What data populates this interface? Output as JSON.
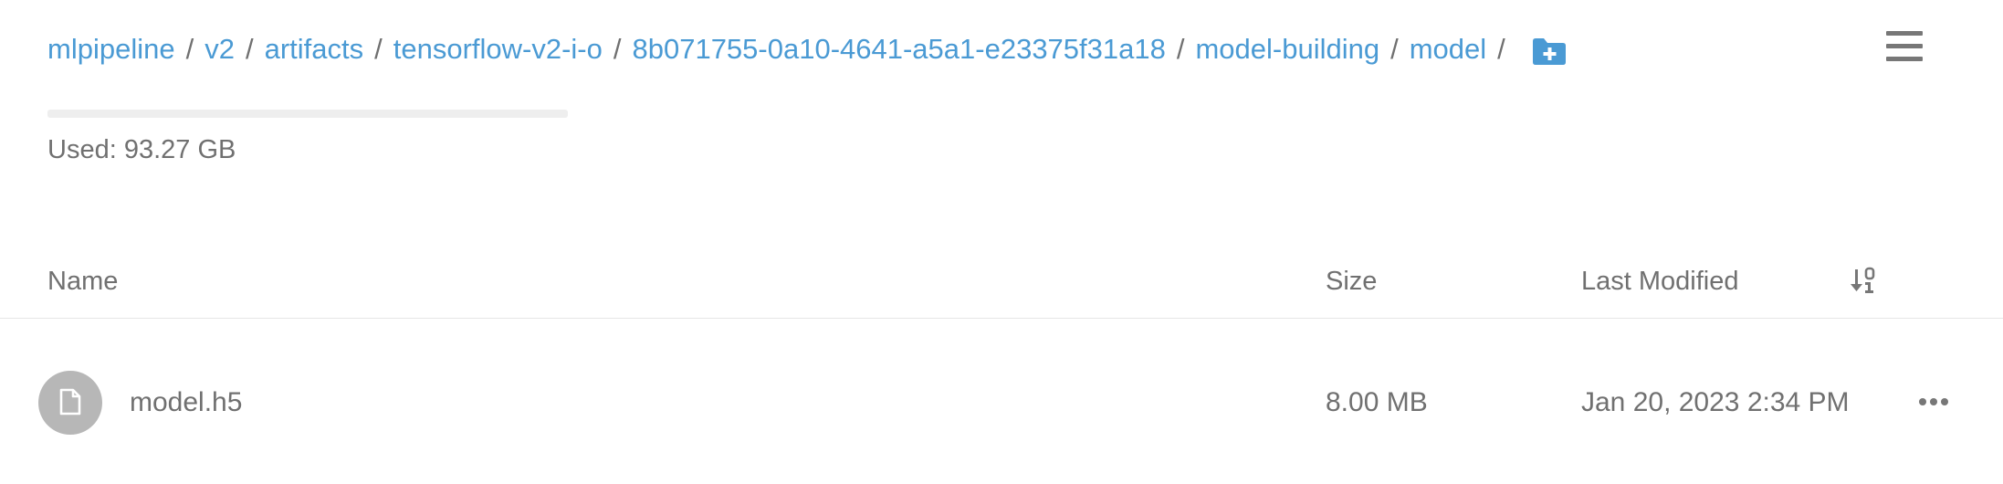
{
  "breadcrumb": {
    "items": [
      {
        "label": "mlpipeline"
      },
      {
        "label": "v2"
      },
      {
        "label": "artifacts"
      },
      {
        "label": "tensorflow-v2-i-o"
      },
      {
        "label": "8b071755-0a10-4641-a5a1-e23375f31a18"
      },
      {
        "label": "model-building"
      },
      {
        "label": "model"
      }
    ],
    "separator": "/",
    "new_folder_icon": "folder-plus-icon"
  },
  "menu_icon": "hamburger-menu-icon",
  "storage": {
    "used_label": "Used: 93.27 GB",
    "usage_fraction": 0
  },
  "table": {
    "columns": {
      "name": "Name",
      "size": "Size",
      "last_modified": "Last Modified"
    },
    "sort_icon": "sort-descending-icon",
    "rows": [
      {
        "name": "model.h5",
        "size": "8.00 MB",
        "last_modified": "Jan 20, 2023 2:34 PM",
        "icon": "file-icon",
        "actions_icon": "more-horizontal-icon"
      }
    ]
  },
  "colors": {
    "link": "#4a9ad4",
    "text": "#707070",
    "avatar": "#b7b7b7",
    "bar_track": "#eeeeee"
  }
}
